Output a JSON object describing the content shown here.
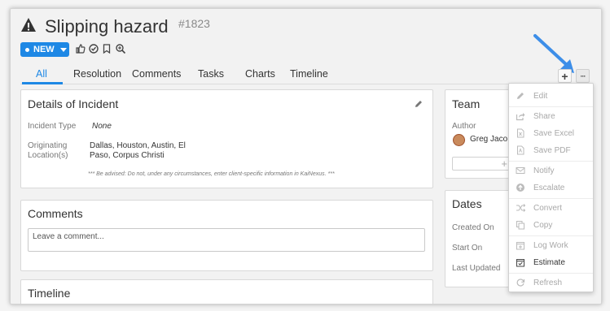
{
  "header": {
    "title": "Slipping hazard",
    "ticket_number": "#1823",
    "status_label": "NEW"
  },
  "tabs": [
    "All",
    "Resolution",
    "Comments",
    "Tasks",
    "Charts",
    "Timeline"
  ],
  "toolbar": {
    "add_label": "+",
    "more_label": "···"
  },
  "details": {
    "title": "Details of Incident",
    "incident_type_label": "Incident Type",
    "incident_type_value": "None",
    "location_label_1": "Originating",
    "location_label_2": "Location(s)",
    "location_value_1": "Dallas, Houston, Austin, El",
    "location_value_2": "Paso, Corpus Christi",
    "advisory": "*** Be advised: Do not, under any circumstances, enter client-specific information in KaiNexus. ***"
  },
  "comments": {
    "title": "Comments",
    "placeholder": "Leave a comment..."
  },
  "timeline": {
    "title": "Timeline"
  },
  "team": {
    "title": "Team",
    "author_label": "Author",
    "author_name": "Greg Jaco"
  },
  "dates": {
    "title": "Dates",
    "created_label": "Created On",
    "start_label": "Start On",
    "updated_label": "Last Updated"
  },
  "menu": {
    "items": [
      "Edit",
      "Share",
      "Save Excel",
      "Save PDF",
      "Notify",
      "Escalate",
      "Convert",
      "Copy",
      "Log Work",
      "Estimate",
      "Refresh"
    ]
  },
  "colors": {
    "accent": "#1e88e5",
    "arrow": "#3d8ee8"
  }
}
